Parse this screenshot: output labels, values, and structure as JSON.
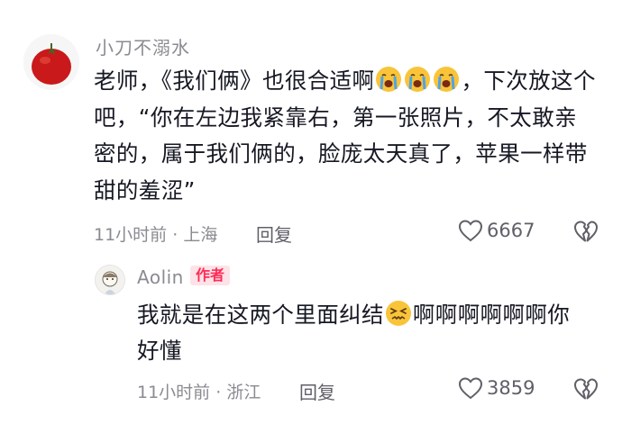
{
  "comment": {
    "username": "小刀不溺水",
    "text_part1": "老师，《我们俩》也很合适啊",
    "emoji_main": "loudly-crying-face",
    "text_part2": "，下次放这个吧，“你在左边我紧靠右，第一张照片，不太敢亲密的，属于我们俩的，脸庞太天真了，苹果一样带甜的羞涩”",
    "time": "11小时前",
    "separator": "·",
    "location": "上海",
    "reply_label": "回复",
    "like_count": "6667"
  },
  "reply": {
    "username": "Aolin",
    "badge": "作者",
    "text_part1": "我就是在这两个里面纠结",
    "emoji": "confounded-face",
    "text_part2": "啊啊啊啊啊啊你好懂",
    "time": "11小时前",
    "separator": "·",
    "location": "浙江",
    "reply_label": "回复",
    "like_count": "3859"
  },
  "colors": {
    "text_primary": "#161823",
    "text_secondary": "#8a8b91",
    "author_badge_bg": "#fde3e8",
    "author_badge_text": "#fe2c55",
    "emoji_face": "#f9c43a"
  }
}
